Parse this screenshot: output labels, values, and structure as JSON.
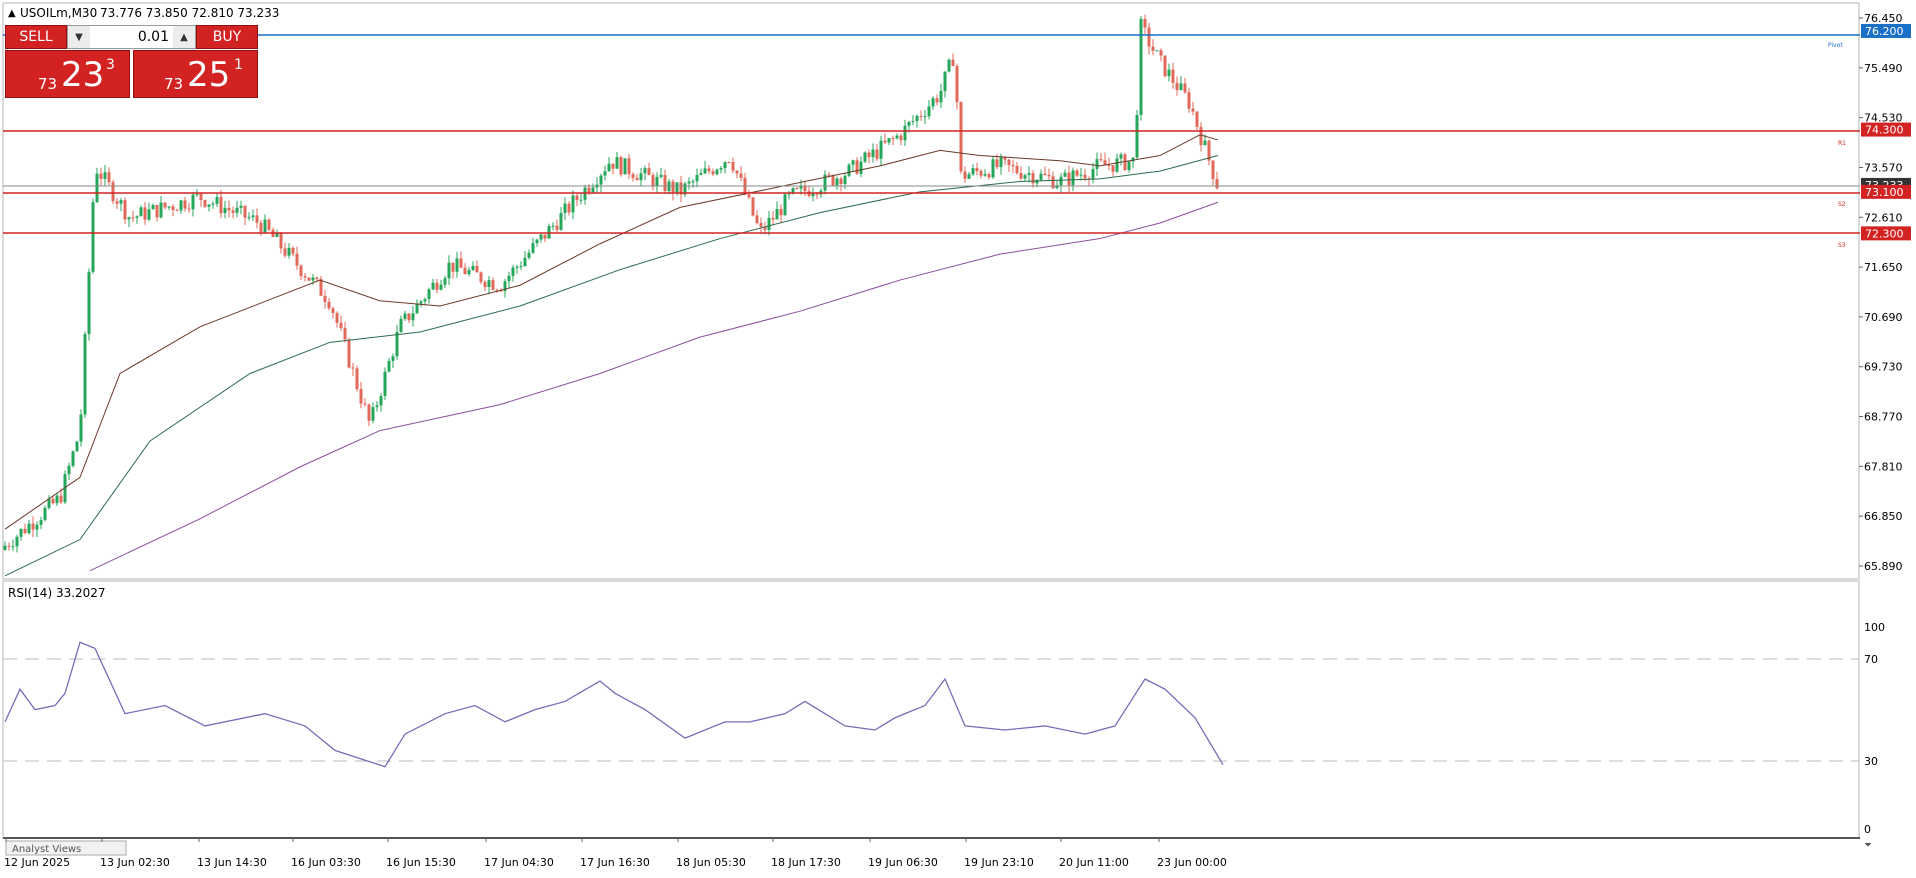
{
  "header": {
    "symbol_timeframe": "USOILm,M30",
    "ohlc": "73.776 73.850 72.810 73.233"
  },
  "trade_panel": {
    "sell_label": "SELL",
    "buy_label": "BUY",
    "lot_value": "0.01",
    "sell_price": {
      "prefix": "73",
      "big": "23",
      "sup": "3"
    },
    "buy_price": {
      "prefix": "73",
      "big": "25",
      "sup": "1"
    }
  },
  "price_axis": {
    "ticks": [
      "76.450",
      "75.490",
      "74.530",
      "73.570",
      "72.610",
      "71.650",
      "70.690",
      "69.730",
      "68.770",
      "67.810",
      "66.850",
      "65.890"
    ],
    "tags": [
      {
        "label": "76.200",
        "color": "#1a6fc9"
      },
      {
        "label": "74.300",
        "color": "#d32222"
      },
      {
        "label": "73.233",
        "color": "#333333"
      },
      {
        "label": "73.100",
        "color": "#d32222"
      },
      {
        "label": "72.300",
        "color": "#d32222"
      }
    ]
  },
  "line_labels": {
    "hline_blue": "Pivot",
    "r1": "R1",
    "s2": "S2",
    "s3": "S3"
  },
  "rsi": {
    "title": "RSI(14) 33.2027",
    "ticks": [
      "100",
      "70",
      "30",
      "0"
    ]
  },
  "time_axis": {
    "labels": [
      "12 Jun 2025",
      "13 Jun 02:30",
      "13 Jun 14:30",
      "16 Jun 03:30",
      "16 Jun 15:30",
      "17 Jun 04:30",
      "17 Jun 16:30",
      "18 Jun 05:30",
      "18 Jun 17:30",
      "19 Jun 06:30",
      "19 Jun 23:10",
      "20 Jun 11:00",
      "23 Jun 00:00"
    ]
  },
  "bottom_tab": {
    "label": "Analyst Views"
  },
  "colors": {
    "bull": "#26a65b",
    "bear": "#e0695a",
    "resistance": "#d32222",
    "pivot": "#1a6fc9",
    "rsi": "#7a6bb7"
  }
}
